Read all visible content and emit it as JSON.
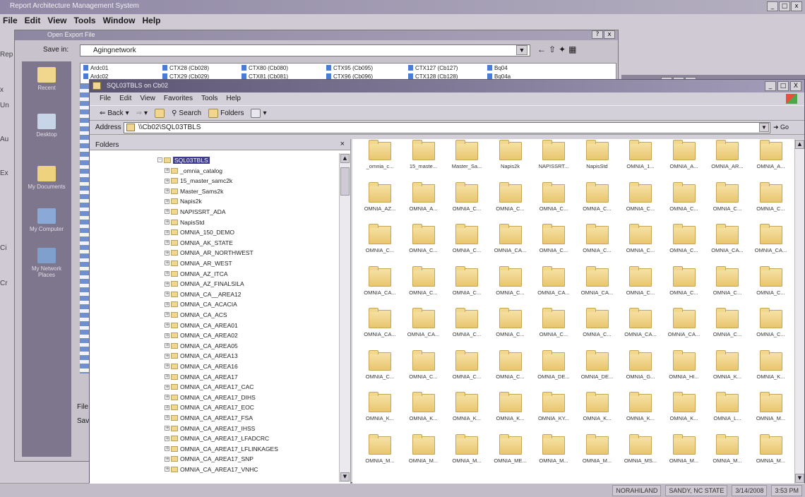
{
  "main_app": {
    "title": "Report Architecture Management System",
    "menu": [
      "File",
      "Edit",
      "View",
      "Tools",
      "Window",
      "Help"
    ],
    "left_strip": [
      "Rep",
      "x",
      "Un",
      "Au",
      "Ex",
      "Ci",
      "Cr"
    ]
  },
  "dialog": {
    "title": "Open Export File",
    "save_in_label": "Save in:",
    "save_in_value": "Agingnetwork",
    "filename_label": "File n",
    "savetype_label": "Save",
    "places": [
      "Recent",
      "Desktop",
      "My Documents",
      "My Computer",
      "My Network Places"
    ],
    "files": [
      "Ardc01",
      "Ardc02",
      "CTX28 (Cb028)",
      "CTX29 (Cb029)",
      "CTX80 (Cb080)",
      "CTX81 (Cb081)",
      "CTX95 (Cb095)",
      "CTX96 (Cb096)",
      "CTX127 (Cb127)",
      "CTX128 (Cb128)",
      "Bq04",
      "Bq04a"
    ]
  },
  "explorer": {
    "title": "SQL03TBLS on Cb02",
    "menu": [
      "File",
      "Edit",
      "View",
      "Favorites",
      "Tools",
      "Help"
    ],
    "toolbar": {
      "back": "Back",
      "search": "Search",
      "folders": "Folders"
    },
    "address_label": "Address",
    "address_value": "\\\\Cb02\\SQL03TBLS",
    "go_label": "Go",
    "folders_header": "Folders",
    "tree_root": "SQL03TBLS",
    "tree_items": [
      "_omnia_catalog",
      "15_master_samc2k",
      "Master_Sams2k",
      "Napis2k",
      "NAPISSRT_ADA",
      "NapisStd",
      "OMNIA_150_DEMO",
      "OMNIA_AK_STATE",
      "OMNIA_AR_NORTHWEST",
      "OMNIA_AR_WEST",
      "OMNIA_AZ_ITCA",
      "OMNIA_AZ_FINALSILA",
      "OMNIA_CA__AREA12",
      "OMNIA_CA_ACACIA",
      "OMNIA_CA_ACS",
      "OMNIA_CA_AREA01",
      "OMNIA_CA_AREA02",
      "OMNIA_CA_AREA05",
      "OMNIA_CA_AREA13",
      "OMNIA_CA_AREA16",
      "OMNIA_CA_AREA17",
      "OMNIA_CA_AREA17_CAC",
      "OMNIA_CA_AREA17_DIHS",
      "OMNIA_CA_AREA17_EOC",
      "OMNIA_CA_AREA17_FSA",
      "OMNIA_CA_AREA17_IHSS",
      "OMNIA_CA_AREA17_LFADCRC",
      "OMNIA_CA_AREA17_LFLINKAGES",
      "OMNIA_CA_AREA17_SNP",
      "OMNIA_CA_AREA17_VNHC"
    ],
    "folder_rows": [
      [
        "_omnia_c...",
        "15_maste...",
        "Master_Sa...",
        "Napis2k",
        "NAPISSRT...",
        "NapisStd",
        "OMNIA_1...",
        "OMNIA_A...",
        "OMNIA_AR...",
        "OMNIA_A..."
      ],
      [
        "OMNIA_AZ...",
        "OMNIA_A...",
        "OMNIA_C...",
        "OMNIA_C...",
        "OMNIA_C...",
        "OMNIA_C...",
        "OMNIA_C...",
        "OMNIA_C...",
        "OMNIA_C...",
        "OMNIA_C..."
      ],
      [
        "OMNIA_C...",
        "OMNIA_C...",
        "OMNIA_C...",
        "OMNIA_CA...",
        "OMNIA_C...",
        "OMNIA_C...",
        "OMNIA_C...",
        "OMNIA_C...",
        "OMNIA_CA...",
        "OMNIA_CA..."
      ],
      [
        "OMNIA_CA...",
        "OMNIA_C...",
        "OMNIA_C...",
        "OMNIA_C...",
        "OMNIA_CA...",
        "OMNIA_CA...",
        "OMNIA_C...",
        "OMNIA_C...",
        "OMNIA_C...",
        "OMNIA_C..."
      ],
      [
        "OMNIA_CA...",
        "OMNIA_CA...",
        "OMNIA_C...",
        "OMNIA_C...",
        "OMNIA_C...",
        "OMNIA_C...",
        "OMNIA_CA...",
        "OMNIA_CA...",
        "OMNIA_C...",
        "OMNIA_C..."
      ],
      [
        "OMNIA_C...",
        "OMNIA_C...",
        "OMNIA_C...",
        "OMNIA_C...",
        "OMNIA_DE...",
        "OMNIA_DE...",
        "OMNIA_G...",
        "OMNIA_HI...",
        "OMNIA_K...",
        "OMNIA_K..."
      ],
      [
        "OMNIA_K...",
        "OMNIA_K...",
        "OMNIA_K...",
        "OMNIA_K...",
        "OMNIA_KY...",
        "OMNIA_K...",
        "OMNIA_K...",
        "OMNIA_K...",
        "OMNIA_L...",
        "OMNIA_M..."
      ],
      [
        "OMNIA_M...",
        "OMNIA_M...",
        "OMNIA_M...",
        "OMNIA_ME...",
        "OMNIA_M...",
        "OMNIA_M...",
        "OMNIA_MS...",
        "OMNIA_M...",
        "OMNIA_M...",
        "OMNIA_M..."
      ]
    ]
  },
  "taskbar": {
    "tray": [
      "NORAHILAND",
      "SANDY, NC STATE",
      "3/14/2008",
      "3:53 PM"
    ]
  },
  "colors": {
    "accent": "#3d3a8f",
    "folder": "#e9c66f",
    "titlebar": "#5b5472"
  }
}
